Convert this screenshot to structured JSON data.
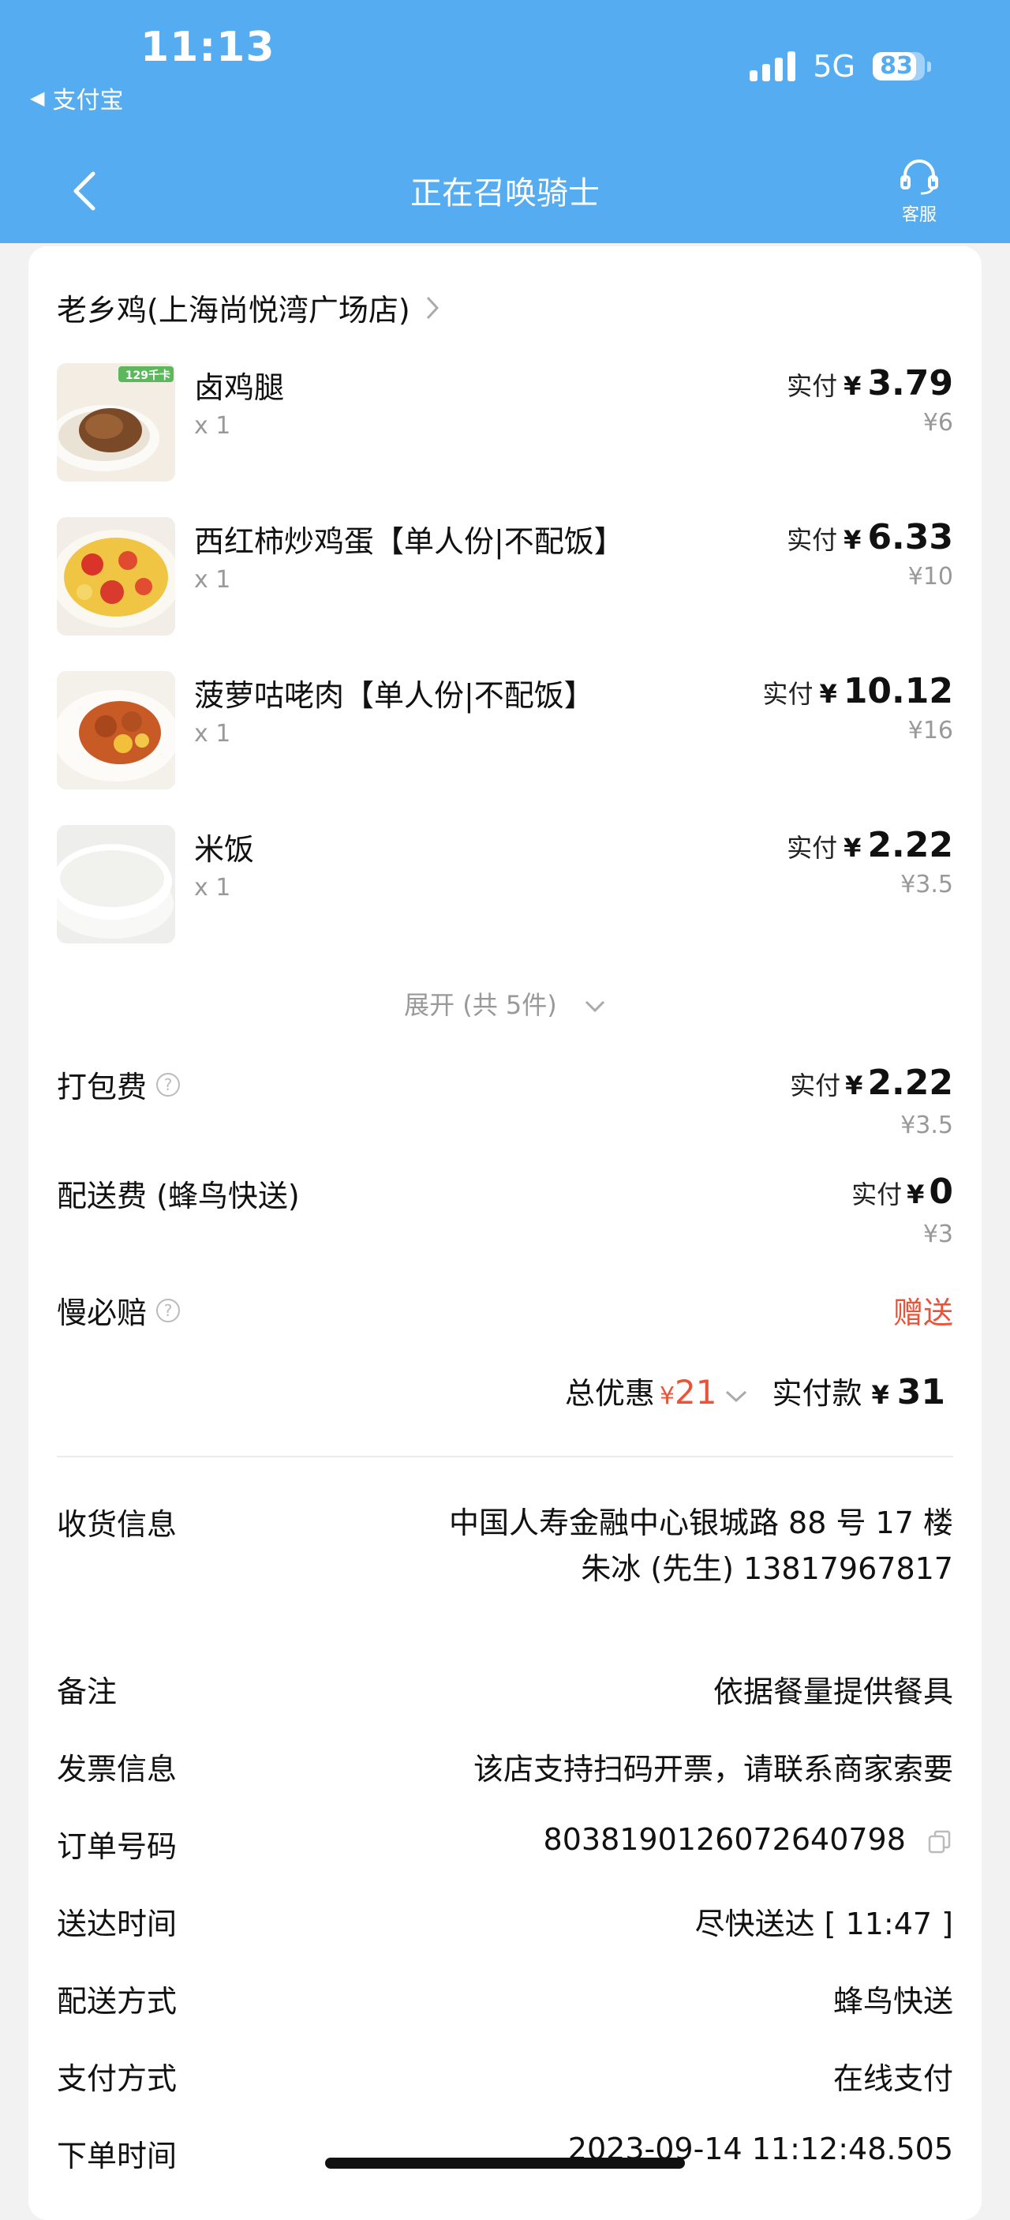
{
  "status_bar": {
    "time": "11:13",
    "back_app": "支付宝",
    "network": "5G",
    "battery": "83",
    "battery_level": 0.83
  },
  "nav": {
    "title": "正在召唤骑士",
    "service_label": "客服"
  },
  "store": {
    "name": "老乡鸡(上海尚悦湾广场店)"
  },
  "items": [
    {
      "name": "卤鸡腿",
      "qty": "x 1",
      "pay_label": "实付",
      "currency": "¥",
      "paid": "3.79",
      "original": "¥6",
      "badge": "129千卡"
    },
    {
      "name": "西红柿炒鸡蛋【单人份|不配饭】",
      "qty": "x 1",
      "pay_label": "实付",
      "currency": "¥",
      "paid": "6.33",
      "original": "¥10"
    },
    {
      "name": "菠萝咕咾肉【单人份|不配饭】",
      "qty": "x 1",
      "pay_label": "实付",
      "currency": "¥",
      "paid": "10.12",
      "original": "¥16"
    },
    {
      "name": "米饭",
      "qty": "x 1",
      "pay_label": "实付",
      "currency": "¥",
      "paid": "2.22",
      "original": "¥3.5"
    }
  ],
  "expand_label": "展开 (共 5件)",
  "fees": {
    "packing": {
      "label": "打包费",
      "pay_label": "实付",
      "currency": "¥",
      "paid": "2.22",
      "original": "¥3.5"
    },
    "delivery": {
      "label": "配送费 (蜂鸟快送)",
      "pay_label": "实付",
      "currency": "¥",
      "paid": "0",
      "original": "¥3"
    },
    "slow": {
      "label": "慢必赔",
      "value": "赠送"
    }
  },
  "totals": {
    "discount_label": "总优惠",
    "discount_currency": "¥",
    "discount_amount": "21",
    "paid_label": "实付款",
    "paid_currency": "¥",
    "paid_amount": "31"
  },
  "info": {
    "address_label": "收货信息",
    "address": "中国人寿金融中心银城路 88 号 17 楼",
    "contact": "朱冰 (先生) 13817967817",
    "note_label": "备注",
    "note": "依据餐量提供餐具",
    "invoice_label": "发票信息",
    "invoice": "该店支持扫码开票，请联系商家索要",
    "order_no_label": "订单号码",
    "order_no": "8038190126072640798",
    "delivery_time_label": "送达时间",
    "delivery_time": "尽快送达 [ 11:47 ]",
    "delivery_method_label": "配送方式",
    "delivery_method": "蜂鸟快送",
    "payment_method_label": "支付方式",
    "payment_method": "在线支付",
    "order_time_label": "下单时间",
    "order_time": "2023-09-14 11:12:48.505"
  },
  "colors": {
    "header_blue": "#55acf0",
    "accent_red": "#e8533a"
  }
}
